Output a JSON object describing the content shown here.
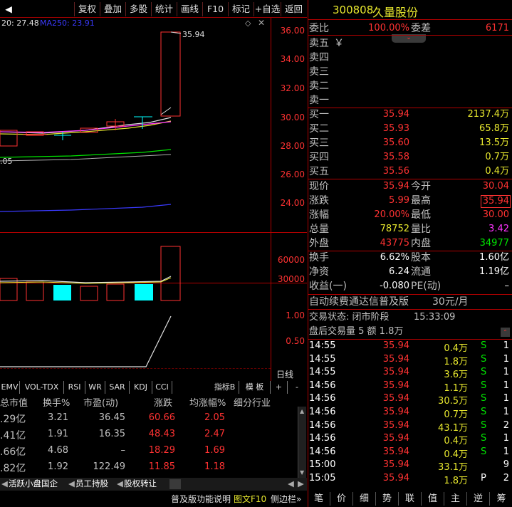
{
  "toolbar": {
    "back_arrow": "◀",
    "items": [
      "复权",
      "叠加",
      "多股",
      "统计",
      "画线",
      "F10",
      "标记",
      "+自选",
      "返回"
    ]
  },
  "chart": {
    "legend_partial": "20: 27.48",
    "legend_ma250": "MA250: 23.91",
    "max_label": "35.94",
    "min_label_partial": ".05",
    "price_ticks": [
      "36.00",
      "34.00",
      "32.00",
      "30.00",
      "28.00",
      "26.00",
      "24.00"
    ],
    "volume_ticks": [
      "60000",
      "30000"
    ],
    "indicator_ticks": [
      "1.00",
      "0.50"
    ],
    "right_label": "日线"
  },
  "indicator_tabs": {
    "items": [
      "EMV",
      "VOL-TDX",
      "RSI",
      "WR",
      "SAR",
      "KDJ",
      "CCI"
    ],
    "index_b": "指标B",
    "template": "模 板",
    "plus": "+",
    "minus": "-"
  },
  "watchlist": {
    "headers": [
      "总市值",
      "换手%",
      "市盈(动)",
      "涨跌",
      "均涨幅%",
      "细分行业"
    ],
    "rows": [
      {
        "mktcap": ".29亿",
        "turnover": "3.21",
        "pe": "36.45",
        "change": "60.66",
        "avg": "2.05"
      },
      {
        "mktcap": ".41亿",
        "turnover": "1.91",
        "pe": "16.35",
        "change": "48.43",
        "avg": "2.47"
      },
      {
        "mktcap": ".66亿",
        "turnover": "4.68",
        "pe": "–",
        "change": "18.29",
        "avg": "1.69"
      },
      {
        "mktcap": ".82亿",
        "turnover": "1.92",
        "pe": "122.49",
        "change": "11.85",
        "avg": "1.18"
      }
    ]
  },
  "bottom_tabs": {
    "items": [
      "活跃小盘国企",
      "员工持股",
      "股权转让"
    ]
  },
  "status_bar": {
    "help": "普及版功能说明",
    "f10": "图文F10",
    "sidebar": "侧边栏»"
  },
  "quote": {
    "code": "300808",
    "name": "久量股份",
    "weibi_label": "委比",
    "weibi_value": "100.00%",
    "weicha_label": "委差",
    "weicha_value": "6171",
    "sells": [
      {
        "label": "卖五",
        "extra": "￥"
      },
      {
        "label": "卖四",
        "extra": ""
      },
      {
        "label": "卖三",
        "extra": ""
      },
      {
        "label": "卖二",
        "extra": ""
      },
      {
        "label": "卖一",
        "extra": ""
      }
    ],
    "buys": [
      {
        "label": "买一",
        "price": "35.94",
        "vol": "2137.4万"
      },
      {
        "label": "买二",
        "price": "35.93",
        "vol": "65.8万"
      },
      {
        "label": "买三",
        "price": "35.60",
        "vol": "13.5万"
      },
      {
        "label": "买四",
        "price": "35.58",
        "vol": "0.7万"
      },
      {
        "label": "买五",
        "price": "35.56",
        "vol": "0.4万"
      }
    ],
    "stats1": [
      {
        "l1": "现价",
        "v1": "35.94",
        "c1": "red",
        "l2": "今开",
        "v2": "30.04",
        "c2": "red"
      },
      {
        "l1": "涨跌",
        "v1": "5.99",
        "c1": "red",
        "l2": "最高",
        "v2": "35.94",
        "c2": "red"
      },
      {
        "l1": "涨幅",
        "v1": "20.00%",
        "c1": "red",
        "l2": "最低",
        "v2": "30.00",
        "c2": "red"
      },
      {
        "l1": "总量",
        "v1": "78752",
        "c1": "yellow",
        "l2": "量比",
        "v2": "3.42",
        "c2": "magenta"
      },
      {
        "l1": "外盘",
        "v1": "43775",
        "c1": "red",
        "l2": "内盘",
        "v2": "34977",
        "c2": "green"
      }
    ],
    "stats2": [
      {
        "l1": "换手",
        "v1": "6.62%",
        "l2": "股本",
        "v2": "1.60亿"
      },
      {
        "l1": "净资",
        "v1": "6.24",
        "l2": "流通",
        "v2": "1.19亿"
      },
      {
        "l1": "收益(一)",
        "v1": "-0.080",
        "l2": "PE(动)",
        "v2": "–"
      }
    ],
    "ad_text": "自动续费通达信普及版",
    "ad_price": "30元/月",
    "trade_status": "交易状态: 闭市阶段",
    "trade_time": "15:33:09",
    "after_hours": "盘后交易量 5 额 1.8万"
  },
  "ticks": [
    {
      "time": "14:55",
      "price": "35.94",
      "vol": "0.4万",
      "side": "S",
      "n": "1"
    },
    {
      "time": "14:55",
      "price": "35.94",
      "vol": "1.8万",
      "side": "S",
      "n": "1"
    },
    {
      "time": "14:55",
      "price": "35.94",
      "vol": "3.6万",
      "side": "S",
      "n": "1"
    },
    {
      "time": "14:56",
      "price": "35.94",
      "vol": "1.1万",
      "side": "S",
      "n": "1"
    },
    {
      "time": "14:56",
      "price": "35.94",
      "vol": "30.5万",
      "side": "S",
      "n": "1"
    },
    {
      "time": "14:56",
      "price": "35.94",
      "vol": "0.7万",
      "side": "S",
      "n": "1"
    },
    {
      "time": "14:56",
      "price": "35.94",
      "vol": "43.1万",
      "side": "S",
      "n": "2"
    },
    {
      "time": "14:56",
      "price": "35.94",
      "vol": "0.4万",
      "side": "S",
      "n": "1"
    },
    {
      "time": "14:56",
      "price": "35.94",
      "vol": "0.4万",
      "side": "S",
      "n": "1"
    },
    {
      "time": "15:00",
      "price": "35.94",
      "vol": "33.1万",
      "side": "",
      "n": "9"
    },
    {
      "time": "15:05",
      "price": "35.94",
      "vol": "1.8万",
      "side": "P",
      "n": "2"
    }
  ],
  "bottom_nav": [
    "笔",
    "价",
    "细",
    "势",
    "联",
    "值",
    "主",
    "逆",
    "筹"
  ]
}
